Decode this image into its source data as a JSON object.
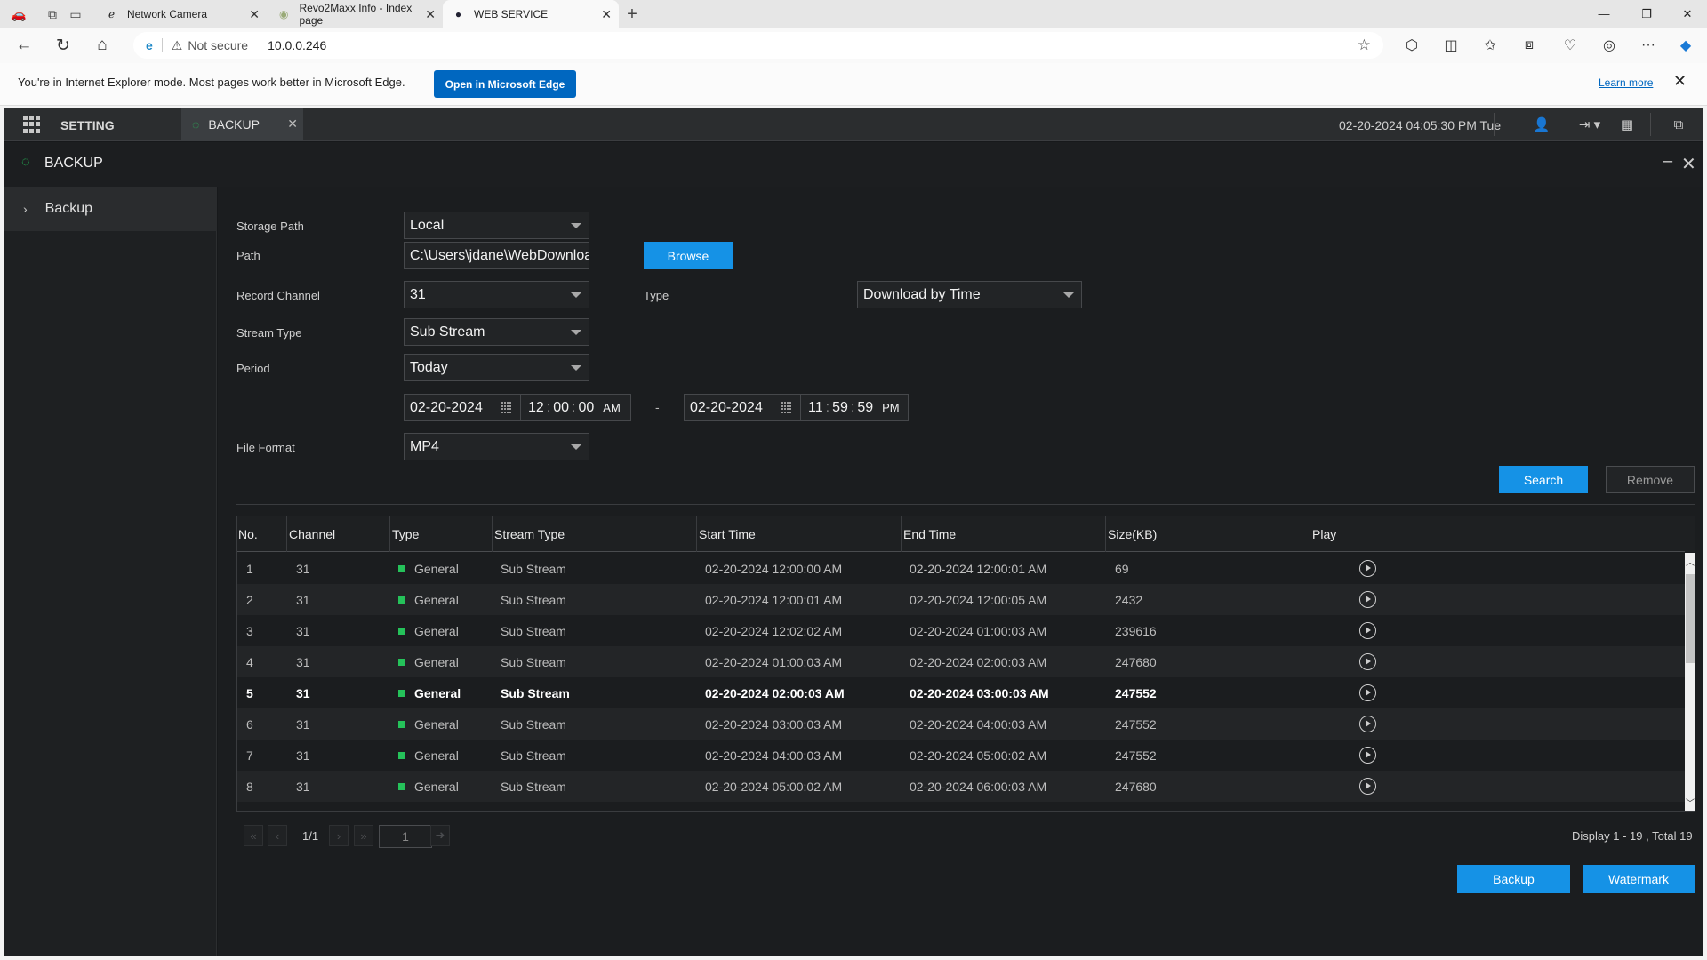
{
  "browser": {
    "tabs": [
      {
        "title": "Network Camera",
        "icon": "ie-icon"
      },
      {
        "title": "Revo2Maxx Info - Index page",
        "icon": "site-icon"
      },
      {
        "title": "WEB SERVICE",
        "icon": "globe-icon"
      }
    ],
    "address": {
      "security": "Not secure",
      "url": "10.0.0.246"
    },
    "ie_bar": {
      "message": "You're in Internet Explorer mode. Most pages work better in Microsoft Edge.",
      "open_button": "Open in Microsoft Edge",
      "learn_more": "Learn more"
    },
    "colors": {
      "accent": "#0067c0"
    }
  },
  "app": {
    "nav": {
      "setting_label": "SETTING",
      "active_tab": "BACKUP",
      "datetime": "02-20-2024 04:05:30 PM Tue"
    },
    "title": "BACKUP",
    "sidebar": {
      "items": [
        {
          "label": "Backup"
        }
      ]
    },
    "form": {
      "storage_path": {
        "label": "Storage Path",
        "value": "Local"
      },
      "path": {
        "label": "Path",
        "value": "C:\\Users\\jdane\\WebDownload\\",
        "browse": "Browse"
      },
      "record_channel": {
        "label": "Record Channel",
        "value": "31"
      },
      "type": {
        "label": "Type",
        "value": "Download by Time"
      },
      "stream_type": {
        "label": "Stream Type",
        "value": "Sub Stream"
      },
      "period": {
        "label": "Period",
        "value": "Today"
      },
      "start": {
        "date": "02-20-2024",
        "hh": "12",
        "mm": "00",
        "ss": "00",
        "ampm": "AM"
      },
      "separator": "-",
      "end": {
        "date": "02-20-2024",
        "hh": "11",
        "mm": "59",
        "ss": "59",
        "ampm": "PM"
      },
      "file_format": {
        "label": "File Format",
        "value": "MP4"
      }
    },
    "buttons": {
      "search": "Search",
      "remove": "Remove",
      "backup": "Backup",
      "watermark": "Watermark"
    },
    "table": {
      "columns": [
        "No.",
        "Channel",
        "Type",
        "Stream Type",
        "Start Time",
        "End Time",
        "Size(KB)",
        "Play"
      ],
      "rows": [
        {
          "no": "1",
          "channel": "31",
          "type": "General",
          "stream": "Sub Stream",
          "start": "02-20-2024 12:00:00 AM",
          "end": "02-20-2024 12:00:01 AM",
          "size": "69"
        },
        {
          "no": "2",
          "channel": "31",
          "type": "General",
          "stream": "Sub Stream",
          "start": "02-20-2024 12:00:01 AM",
          "end": "02-20-2024 12:00:05 AM",
          "size": "2432"
        },
        {
          "no": "3",
          "channel": "31",
          "type": "General",
          "stream": "Sub Stream",
          "start": "02-20-2024 12:02:02 AM",
          "end": "02-20-2024 01:00:03 AM",
          "size": "239616"
        },
        {
          "no": "4",
          "channel": "31",
          "type": "General",
          "stream": "Sub Stream",
          "start": "02-20-2024 01:00:03 AM",
          "end": "02-20-2024 02:00:03 AM",
          "size": "247680"
        },
        {
          "no": "5",
          "channel": "31",
          "type": "General",
          "stream": "Sub Stream",
          "start": "02-20-2024 02:00:03 AM",
          "end": "02-20-2024 03:00:03 AM",
          "size": "247552"
        },
        {
          "no": "6",
          "channel": "31",
          "type": "General",
          "stream": "Sub Stream",
          "start": "02-20-2024 03:00:03 AM",
          "end": "02-20-2024 04:00:03 AM",
          "size": "247552"
        },
        {
          "no": "7",
          "channel": "31",
          "type": "General",
          "stream": "Sub Stream",
          "start": "02-20-2024 04:00:03 AM",
          "end": "02-20-2024 05:00:02 AM",
          "size": "247552"
        },
        {
          "no": "8",
          "channel": "31",
          "type": "General",
          "stream": "Sub Stream",
          "start": "02-20-2024 05:00:02 AM",
          "end": "02-20-2024 06:00:03 AM",
          "size": "247680"
        }
      ]
    },
    "pager": {
      "page": "1/1",
      "input": "1",
      "display": "Display 1 - 19 , Total 19"
    },
    "colors": {
      "accent": "#1592e6",
      "status_green": "#25c25a",
      "background": "#1b1d1f"
    }
  }
}
